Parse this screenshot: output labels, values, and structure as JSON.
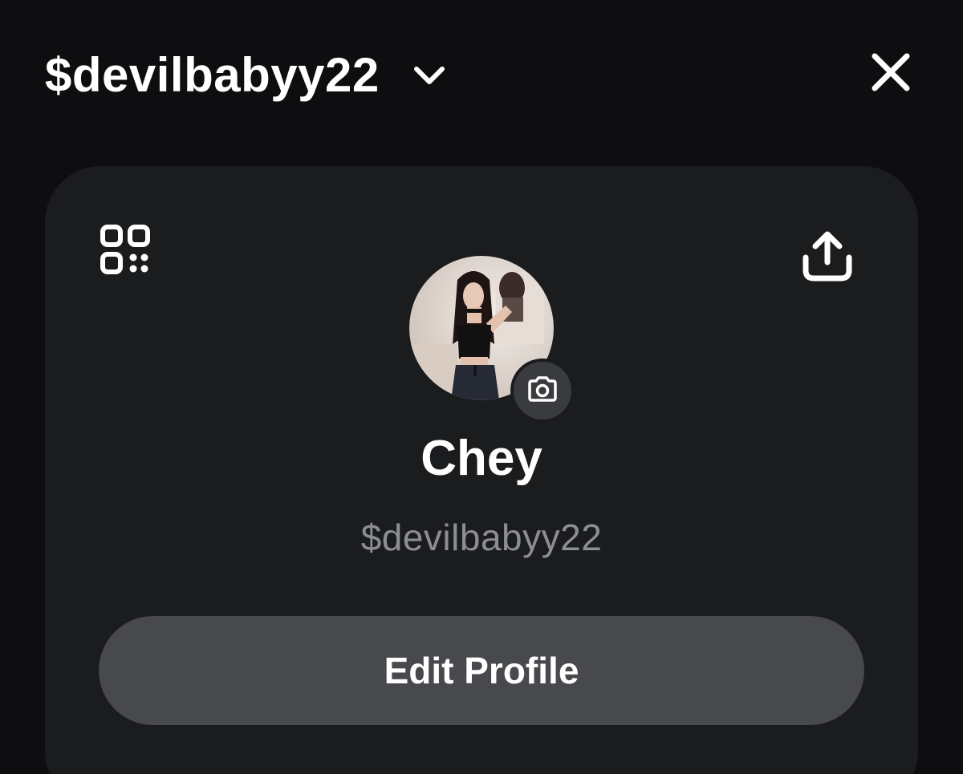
{
  "header": {
    "title": "$devilbabyy22",
    "dropdown_icon": "chevron-down-icon",
    "close_icon": "close-icon"
  },
  "profile_card": {
    "qr_icon": "qr-code-icon",
    "share_icon": "share-icon",
    "avatar_alt": "profile photo",
    "camera_icon": "camera-icon",
    "display_name": "Chey",
    "cashtag": "$devilbabyy22",
    "edit_button_label": "Edit Profile"
  },
  "colors": {
    "background": "#0e0e10",
    "card": "#1b1c1e",
    "button": "#48494c",
    "secondary_text": "#8d8e92"
  }
}
